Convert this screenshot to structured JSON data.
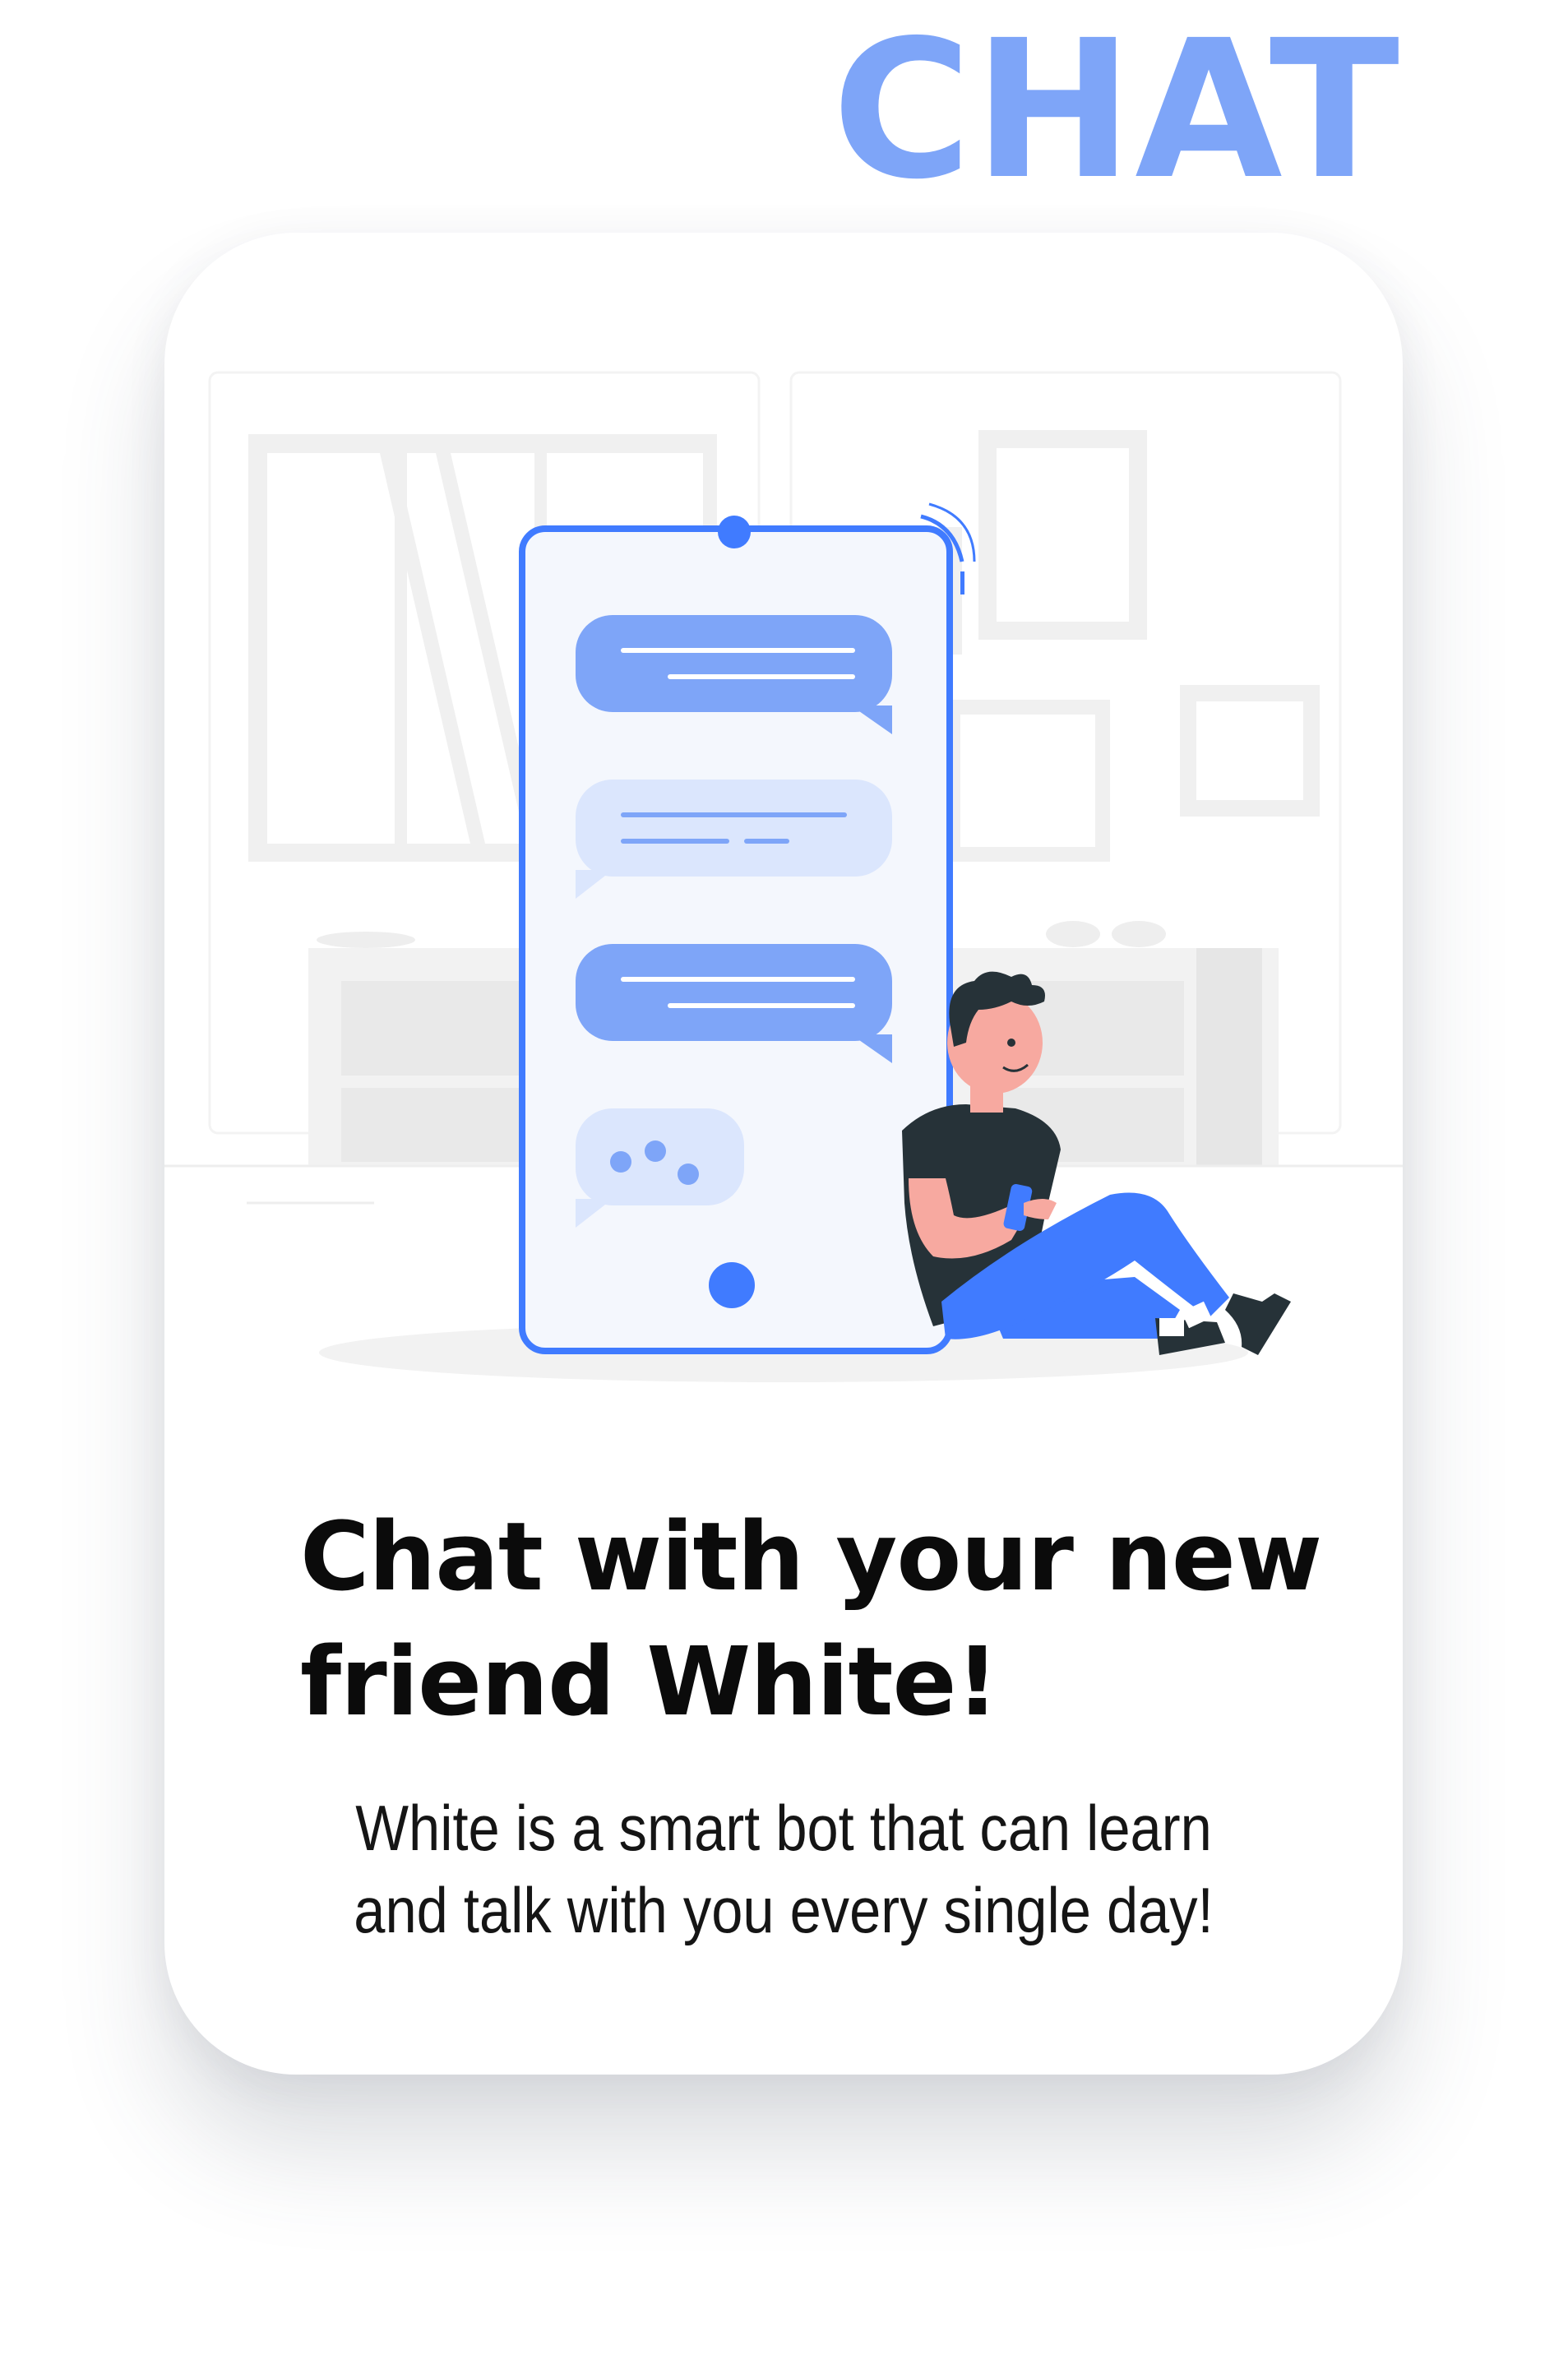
{
  "app": {
    "brand_title": "CHAT"
  },
  "onboarding": {
    "headline": "Chat with your new friend White!",
    "subtitle": "White is a smart bot that can learn and talk with you every single day!"
  },
  "illustration": {
    "phone_messages": [
      "outgoing-message",
      "incoming-message",
      "outgoing-message",
      "typing-indicator"
    ],
    "colors": {
      "primary": "#407bff",
      "primary_light": "#7ea5f8",
      "bubble_light": "#dbe6fd",
      "phone_screen": "#f4f7fd",
      "background_shapes": "#f2f2f2",
      "shirt": "#263238",
      "skin": "#f7a9a0"
    }
  }
}
